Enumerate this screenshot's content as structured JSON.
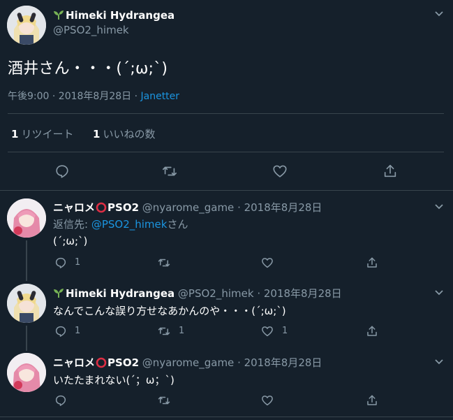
{
  "main_tweet": {
    "display_name": "Himeki Hydrangea",
    "handle": "@PSO2_himek",
    "text": "酒井さん・・・(´;ω;`)",
    "time": "午後9:00 · 2018年8月28日 · ",
    "client": "Janetter",
    "retweets_count": "1",
    "retweets_label": "リツイート",
    "likes_count": "1",
    "likes_label": "いいねの数"
  },
  "replies": [
    {
      "display_name": "ニャロメ",
      "display_suffix": "PSO2",
      "handle": "@nyarome_game",
      "date": "· 2018年8月28日",
      "reply_to_prefix": "返信先: ",
      "reply_to_handle": "@PSO2_himek",
      "reply_to_suffix": "さん",
      "text": "(´;ω;`)",
      "reply_count": "1",
      "retweet_count": "",
      "like_count": ""
    },
    {
      "display_name": "Himeki Hydrangea",
      "handle": "@PSO2_himek",
      "date": "· 2018年8月28日",
      "text": "なんでこんな誤り方せなあかんのや・・・(´;ω;`)",
      "reply_count": "1",
      "retweet_count": "1",
      "like_count": "1"
    },
    {
      "display_name": "ニャロメ",
      "display_suffix": "PSO2",
      "handle": "@nyarome_game",
      "date": "· 2018年8月28日",
      "text": "いたたまれない(´；ω；`)",
      "reply_count": "",
      "retweet_count": "",
      "like_count": ""
    }
  ],
  "icons": {
    "reply": "reply-icon",
    "retweet": "retweet-icon",
    "like": "heart-icon",
    "share": "share-icon",
    "more": "chevron-down-icon"
  },
  "colors": {
    "background": "#15202b",
    "text": "#ffffff",
    "muted": "#8899a6",
    "link": "#1b95e0",
    "divider": "#38444d",
    "sprout": "#77b255",
    "circle": "#dd2e44"
  }
}
